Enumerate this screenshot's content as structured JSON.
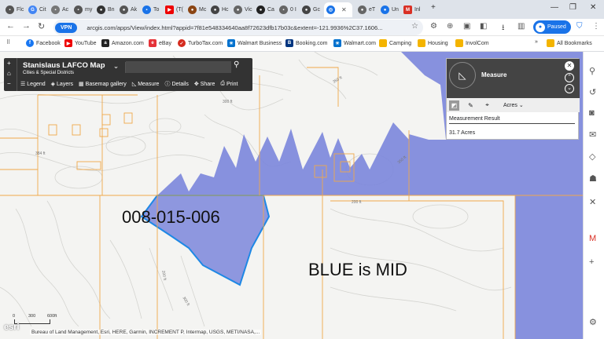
{
  "browser": {
    "tabs": [
      {
        "label": "Flc",
        "icon": "square-icon",
        "color": "#555"
      },
      {
        "label": "Cit",
        "icon": "google-icon",
        "color": "#4285f4"
      },
      {
        "label": "Ac",
        "icon": "square-icon",
        "color": "#777"
      },
      {
        "label": "my",
        "icon": "square-icon",
        "color": "#555"
      },
      {
        "label": "Bn",
        "icon": "circle-icon",
        "color": "#333"
      },
      {
        "label": "Ak",
        "icon": "circle-icon",
        "color": "#555"
      },
      {
        "label": "To",
        "icon": "square-icon",
        "color": "#1a73e8"
      },
      {
        "label": "(T(",
        "icon": "youtube-icon",
        "color": "#e00"
      },
      {
        "label": "Mc",
        "icon": "circle-icon",
        "color": "#8b4513"
      },
      {
        "label": "Hc",
        "icon": "circle-icon",
        "color": "#444"
      },
      {
        "label": "Vic",
        "icon": "circle-icon",
        "color": "#666"
      },
      {
        "label": "Ca",
        "icon": "circle-icon",
        "color": "#222"
      },
      {
        "label": "0 I",
        "icon": "square-icon",
        "color": "#666"
      },
      {
        "label": "Gc",
        "icon": "circle-icon",
        "color": "#444"
      },
      {
        "label": "",
        "icon": "globe-icon",
        "color": "#1a73e8",
        "active": true
      },
      {
        "label": "eT",
        "icon": "circle-icon",
        "color": "#666"
      },
      {
        "label": "Un",
        "icon": "circle-icon",
        "color": "#1a73e8"
      },
      {
        "label": "Inl",
        "icon": "gmail-icon",
        "color": "#d93025"
      }
    ],
    "url": "arcgis.com/apps/View/index.html?appid=7f81e548334640aa8f72623dfb17b03c&extent=-121.9936%2C37.1606...",
    "vpn_label": "VPN",
    "profile_label": "Paused",
    "bookmarks": [
      {
        "label": "Facebook",
        "color": "#1877f2"
      },
      {
        "label": "YouTube",
        "color": "#e00"
      },
      {
        "label": "Amazon.com",
        "color": "#222"
      },
      {
        "label": "eBay",
        "color": "#e53238"
      },
      {
        "label": "TurboTax.com",
        "color": "#d52b1e"
      },
      {
        "label": "Walmart Business",
        "color": "#0071ce"
      },
      {
        "label": "Booking.com",
        "color": "#003580"
      },
      {
        "label": "Walmart.com",
        "color": "#0071ce"
      },
      {
        "label": "Camping",
        "color": "#f4b400"
      },
      {
        "label": "Housing",
        "color": "#f4b400"
      },
      {
        "label": "InvolCom",
        "color": "#f4b400"
      }
    ],
    "all_bookmarks_label": "All Bookmarks"
  },
  "app": {
    "title": "Stanislaus LAFCO Map",
    "subtitle": "Cities & Special Districts",
    "menu": {
      "legend": "Legend",
      "layers": "Layers",
      "basemap": "Basemap gallery",
      "measure": "Measure",
      "details": "Details",
      "share": "Share",
      "print": "Print"
    }
  },
  "measure_panel": {
    "title": "Measure",
    "unit": "Acres",
    "result_label": "Measurement Result",
    "result_value": "31.7 Acres"
  },
  "map": {
    "parcel_label": "008-015-006",
    "annotation": "BLUE is MID",
    "contour_labels": [
      "300 ft",
      "350 ft",
      "384 ft",
      "350 ft",
      "200 ft",
      "300 ft",
      "200 ft"
    ],
    "scale_labels": [
      "0",
      "300",
      "600ft"
    ],
    "esri_logo": "esri",
    "attribution": "Bureau of Land Management, Esri, HERE, Garmin, INCREMENT P, Intermap, USGS, METI/NASA,..."
  },
  "colors": {
    "district_fill": "#7b86dc",
    "parcel_outline": "#1e88e5",
    "parcel_lines": "#f0a84a",
    "accent": "#1a73e8"
  }
}
